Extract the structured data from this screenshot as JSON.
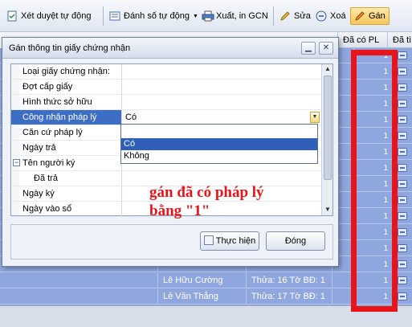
{
  "toolbar": {
    "buttons": [
      {
        "label": "Xét duyệt tự động",
        "icon": "document-check-icon"
      },
      {
        "label": "Đánh số tự động",
        "icon": "numbering-icon"
      },
      {
        "label": "Xuất, in GCN",
        "icon": "printer-icon"
      },
      {
        "label": "Sửa",
        "icon": "pencil-icon"
      },
      {
        "label": "Xoá",
        "icon": "minus-circle-icon"
      },
      {
        "label": "Gán",
        "icon": "pencil-assign-icon"
      }
    ]
  },
  "grid": {
    "headers": [
      "Đã có PL",
      "Đã tì"
    ],
    "rows": [
      {
        "name": "",
        "loc": "",
        "pl": "1"
      },
      {
        "name": "",
        "loc": "",
        "pl": "1"
      },
      {
        "name": "",
        "loc": "",
        "pl": "1"
      },
      {
        "name": "",
        "loc": "",
        "pl": "1"
      },
      {
        "name": "",
        "loc": "",
        "pl": "1"
      },
      {
        "name": "",
        "loc": "",
        "pl": "1"
      },
      {
        "name": "",
        "loc": "",
        "pl": "1"
      },
      {
        "name": "",
        "loc": "",
        "pl": "1"
      },
      {
        "name": "",
        "loc": "",
        "pl": "1"
      },
      {
        "name": "",
        "loc": "",
        "pl": "1"
      },
      {
        "name": "",
        "loc": "",
        "pl": "1"
      },
      {
        "name": "",
        "loc": "",
        "pl": "1"
      },
      {
        "name": "",
        "loc": "",
        "pl": "1"
      },
      {
        "name": "",
        "loc": "",
        "pl": "1"
      },
      {
        "name": "Lê Hữu Cường",
        "loc": "Thửa: 16 Tờ BĐ: 1",
        "pl": "1"
      },
      {
        "name": "Lê Văn Thắng",
        "loc": "Thửa: 17 Tờ BĐ: 1",
        "pl": "1"
      }
    ]
  },
  "dialog": {
    "title": "Gán thông tin giấy chứng nhận",
    "properties": [
      {
        "label": "Loại giấy chứng nhận:",
        "value": ""
      },
      {
        "label": "Đợt cấp giấy",
        "value": ""
      },
      {
        "label": "Hình thức sở hữu",
        "value": ""
      },
      {
        "label": "Công nhận pháp lý",
        "value": "Có"
      },
      {
        "label": "Căn cứ pháp lý",
        "value": ""
      },
      {
        "label": "Ngày trả",
        "value": ""
      },
      {
        "label": "Tên người ký",
        "value": ""
      },
      {
        "label": "Đã trả",
        "value": ""
      },
      {
        "label": "Ngày ký",
        "value": ""
      },
      {
        "label": "Ngày vào sổ",
        "value": ""
      }
    ],
    "dropdown_options": [
      "Có",
      "Không"
    ],
    "execute_label": "Thực hiện",
    "close_label": "Đóng"
  },
  "annotation": {
    "line1": "gán đã có pháp lý",
    "line2": "bằng \"1\"",
    "color": "#e8141a"
  }
}
